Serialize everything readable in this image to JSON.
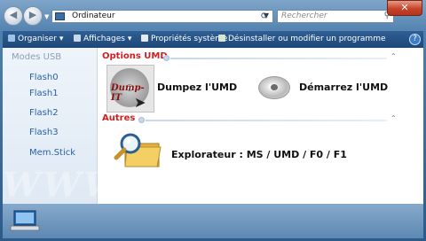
{
  "address": {
    "crumb": "Ordinateur"
  },
  "search": {
    "placeholder": "Rechercher"
  },
  "toolbar": {
    "items": [
      "Organiser",
      "Affichages",
      "Propriétés système",
      "Désinstaller ou modifier un programme"
    ]
  },
  "sidebar": {
    "heading": "Modes USB",
    "items": [
      "Flash0",
      "Flash1",
      "Flash2",
      "Flash3",
      "Mem.Stick"
    ]
  },
  "sections": {
    "umd": {
      "title": "Options UMD",
      "dump_icon_text": "Dump-IT",
      "dump_label": "Dumpez l'UMD",
      "start_label": "Démarrez l'UMD"
    },
    "other": {
      "title": "Autres",
      "explorer_label": "Explorateur : MS / UMD / F0 / F1"
    }
  },
  "watermark": "WWW.PSPGEN.COM",
  "colors": {
    "section_title": "#d21e1e",
    "sidebar_link": "#2a5fa8",
    "toolbar": "#1d4676"
  }
}
